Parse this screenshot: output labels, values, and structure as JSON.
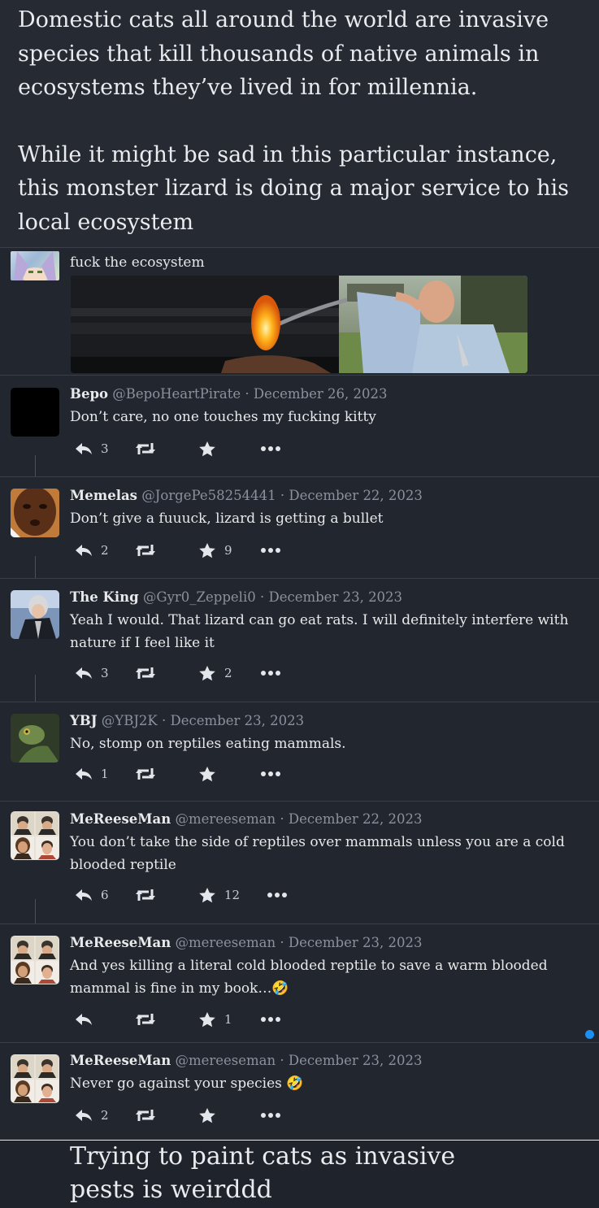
{
  "top_comment": {
    "paragraphs": [
      "Domestic cats all around the world are invasive species that kill thousands of native animals in ecosystems they’ve lived in for millennia.",
      "While it might be sad in this particular instance, this monster lizard is doing a major service to his local ecosystem"
    ]
  },
  "reply_image_post": {
    "text": "fuck the ecosystem"
  },
  "posts": [
    {
      "name": "Bepo",
      "handle": "@BepoHeartPirate",
      "date": "· December 26, 2023",
      "text": "Don’t care, no one touches my fucking kitty",
      "replies": "3",
      "reposts": "",
      "likes": ""
    },
    {
      "name": "Memelas",
      "handle": "@JorgePe58254441",
      "date": "· December 22, 2023",
      "text": "Don’t give a fuuuck, lizard is getting a bullet",
      "replies": "2",
      "reposts": "",
      "likes": "9"
    },
    {
      "name": "The King",
      "handle": "@Gyr0_Zeppeli0",
      "date": "· December 23, 2023",
      "text": "Yeah I would. That lizard can go eat rats. I will definitely interfere with nature if I feel like it",
      "replies": "3",
      "reposts": "",
      "likes": "2"
    },
    {
      "name": "YBJ",
      "handle": "@YBJ2K",
      "date": "· December 23, 2023",
      "text": "No, stomp on reptiles eating mammals.",
      "replies": "1",
      "reposts": "",
      "likes": ""
    },
    {
      "name": "MeReeseMan",
      "handle": "@mereeseman",
      "date": "· December 22, 2023",
      "text": "You don’t take the side of reptiles over mammals unless you are a cold blooded reptile",
      "replies": "6",
      "reposts": "",
      "likes": "12"
    },
    {
      "name": "MeReeseMan",
      "handle": "@mereeseman",
      "date": "· December 23, 2023",
      "text": "And yes killing a literal cold blooded reptile to save a warm blooded mammal is fine in my book…🤣",
      "replies": "",
      "reposts": "",
      "likes": "1"
    },
    {
      "name": "MeReeseMan",
      "handle": "@mereeseman",
      "date": "· December 23, 2023",
      "text": "Never go against your species 🤣",
      "replies": "2",
      "reposts": "",
      "likes": ""
    }
  ],
  "bottom_comment": {
    "text": "Trying to paint cats as invasive pests is weirddd"
  },
  "icons": {
    "reply": "reply-icon",
    "repost": "repost-icon",
    "like": "star-icon",
    "more": "more-icon"
  },
  "colors": {
    "background": "#22262f",
    "text": "#e7e9ea",
    "muted": "#8b919c",
    "accent_dot": "#1d8ff0"
  }
}
